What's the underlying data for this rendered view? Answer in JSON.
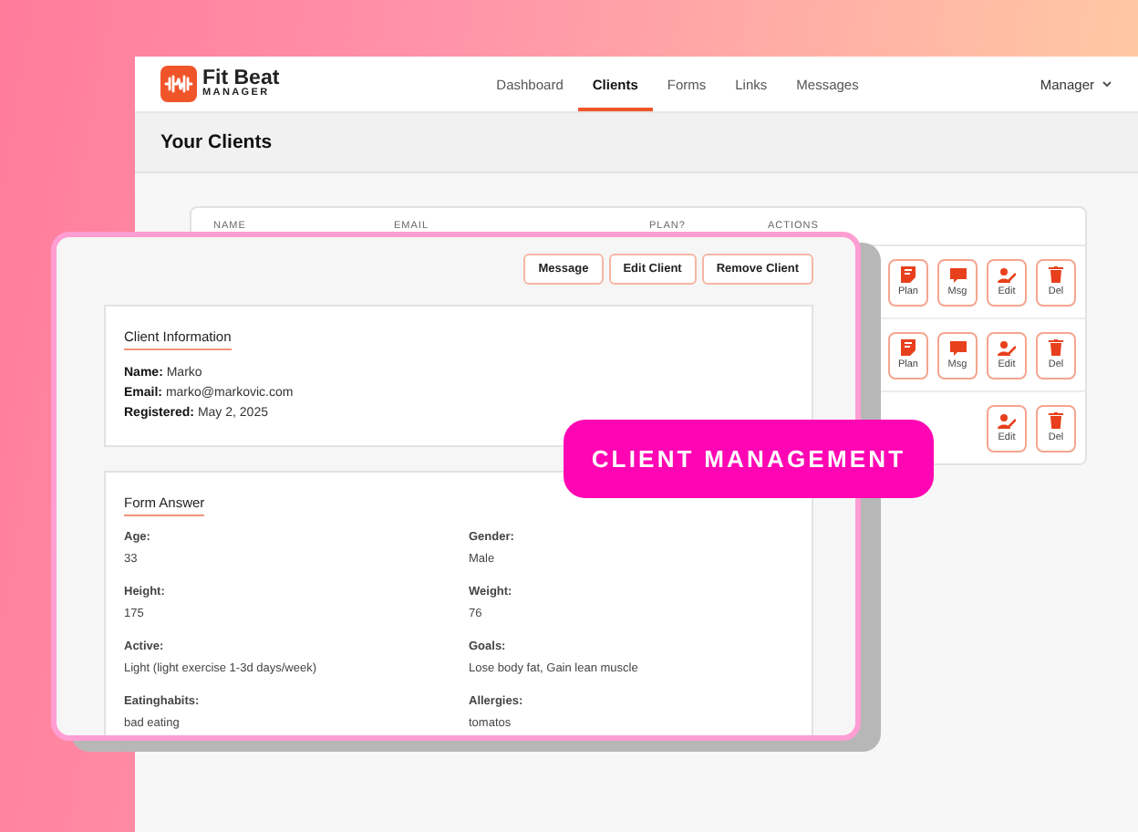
{
  "header": {
    "logo": {
      "name": "Fit Beat",
      "subtitle": "MANAGER"
    },
    "nav": [
      {
        "label": "Dashboard",
        "selected": false
      },
      {
        "label": "Clients",
        "selected": true
      },
      {
        "label": "Forms",
        "selected": false
      },
      {
        "label": "Links",
        "selected": false
      },
      {
        "label": "Messages",
        "selected": false
      }
    ],
    "user_menu": "Manager"
  },
  "page_title": "Your Clients",
  "table": {
    "columns": [
      "NAME",
      "EMAIL",
      "PLAN?",
      "ACTIONS"
    ],
    "rows": [
      {
        "actions": [
          {
            "kind": "plan",
            "label": "Plan"
          },
          {
            "kind": "message",
            "label": "Msg"
          },
          {
            "kind": "edit",
            "label": "Edit"
          },
          {
            "kind": "delete",
            "label": "Del"
          }
        ]
      },
      {
        "actions": [
          {
            "kind": "plan",
            "label": "Plan"
          },
          {
            "kind": "message",
            "label": "Msg"
          },
          {
            "kind": "edit",
            "label": "Edit"
          },
          {
            "kind": "delete",
            "label": "Del"
          }
        ]
      },
      {
        "actions": [
          {
            "kind": "edit",
            "label": "Edit"
          },
          {
            "kind": "delete",
            "label": "Del"
          }
        ]
      }
    ]
  },
  "client_panel": {
    "buttons": [
      "Message",
      "Edit Client",
      "Remove Client"
    ],
    "info": {
      "title": "Client Information",
      "lines": [
        "**Name:** Marko",
        "**Email:** marko@markovic.com",
        "**Registered:** May 2, 2025"
      ]
    },
    "form": {
      "title": "Form Answer",
      "fields": [
        {
          "label": "Age:",
          "value": "33"
        },
        {
          "label": "Gender:",
          "value": "Male"
        },
        {
          "label": "Height:",
          "value": "175"
        },
        {
          "label": "Weight:",
          "value": "76"
        },
        {
          "label": "Active:",
          "value": "Light (light exercise 1-3d days/week)"
        },
        {
          "label": "Goals:",
          "value": "Lose body fat, Gain lean muscle"
        },
        {
          "label": "Eatinghabits:",
          "value": "bad eating"
        },
        {
          "label": "Allergies:",
          "value": "tomatos"
        }
      ]
    }
  },
  "badge": "CLIENT MANAGEMENT"
}
